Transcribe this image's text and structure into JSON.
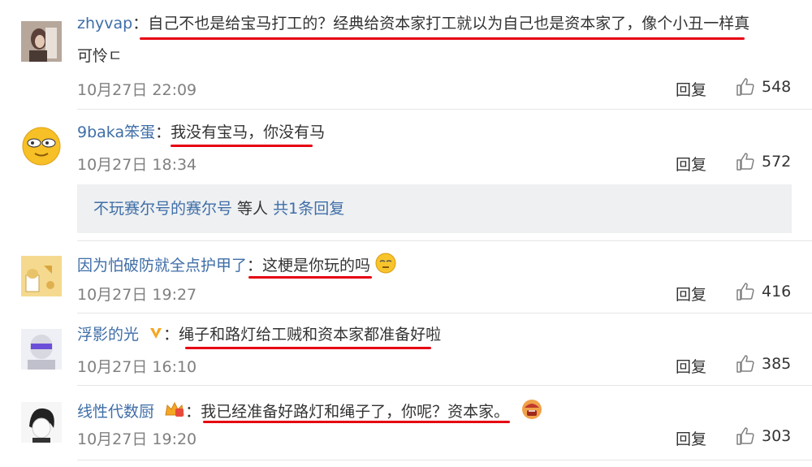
{
  "comments": [
    {
      "username": "zhyvap",
      "colon": "：",
      "text": "自己不也是给宝马打工的？经典给资本家打工就以为自己也是资本家了，像个小丑一样真",
      "text_cont": "可怜ㄷ",
      "time": "10月27日 22:09",
      "reply": "回复",
      "likes": "548"
    },
    {
      "username": "9baka笨蛋",
      "colon": "：",
      "text": "我没有宝马，你没有马",
      "time": "10月27日 18:34",
      "reply": "回复",
      "likes": "572"
    },
    {
      "username": "因为怕破防就全点护甲了",
      "colon": "：",
      "text": "这梗是你玩的吗",
      "time": "10月27日 19:27",
      "reply": "回复",
      "likes": "416"
    },
    {
      "username": "浮影的光",
      "colon": "：",
      "text": "绳子和路灯给工贼和资本家都准备好啦",
      "time": "10月27日 16:10",
      "reply": "回复",
      "likes": "385"
    },
    {
      "username": "线性代数厨",
      "colon": "：",
      "text": "我已经准备好路灯和绳子了，你呢？资本家。",
      "time": "10月27日 19:20",
      "reply": "回复",
      "likes": "303"
    }
  ],
  "subreply": {
    "user": "不玩赛尔号的赛尔号",
    "middle": " 等人 ",
    "count_link": "共1条回复"
  },
  "colors": {
    "username": "#3f6ea7",
    "underline": "#e60012",
    "subreply_bg": "#eef0f2",
    "vip_badge": "#f5a623"
  }
}
